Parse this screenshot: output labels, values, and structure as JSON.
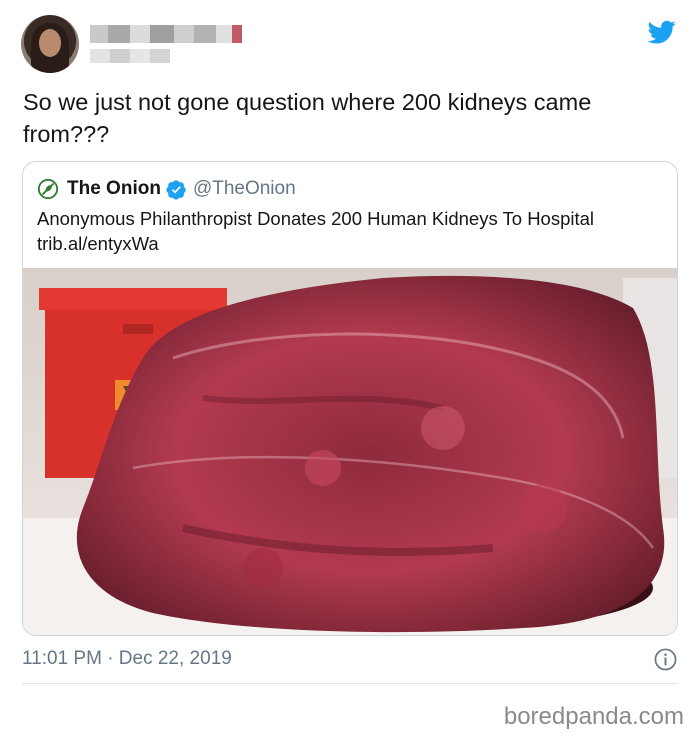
{
  "tweet": {
    "text": "So we just not gone question where 200 kidneys came from???",
    "timestamp": "11:01 PM · Dec 22, 2019"
  },
  "quoted_tweet": {
    "name": "The Onion",
    "handle": "@TheOnion",
    "text": "Anonymous Philanthropist Donates 200 Human Kidneys To Hospital trib.al/entyxWa"
  },
  "watermark": "boredpanda.com",
  "icons": {
    "brand": "twitter-bird-icon",
    "verified": "verified-badge-icon",
    "info": "info-icon",
    "onion_logo": "onion-logo-icon"
  },
  "colors": {
    "twitter_blue": "#1da1f2",
    "secondary_text": "#657786",
    "border": "#ccd6dd"
  }
}
